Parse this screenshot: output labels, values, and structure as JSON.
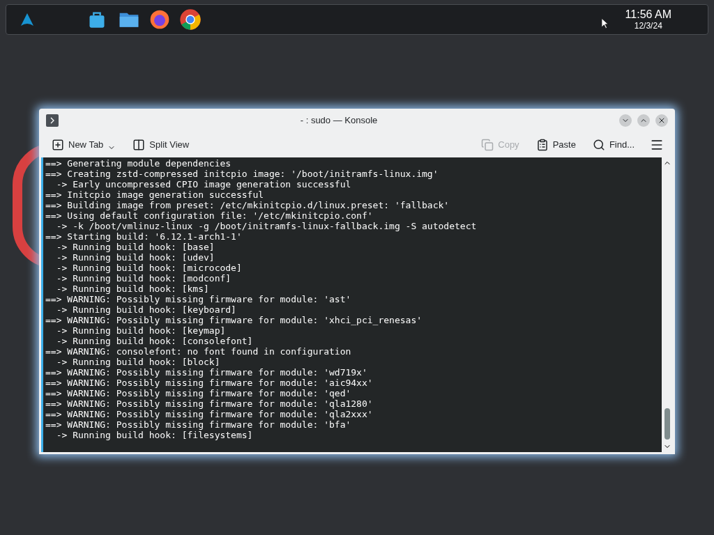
{
  "taskbar": {
    "clock": {
      "time": "11:56 AM",
      "date": "12/3/24"
    }
  },
  "window": {
    "title": "- : sudo — Konsole"
  },
  "toolbar": {
    "left": [
      {
        "label": "New Tab",
        "kind": "newtab",
        "disabled": false
      },
      {
        "label": "Split View",
        "kind": "split",
        "disabled": false
      }
    ],
    "right": [
      {
        "label": "Copy",
        "kind": "copy",
        "disabled": true
      },
      {
        "label": "Paste",
        "kind": "paste",
        "disabled": false
      },
      {
        "label": "Find...",
        "kind": "find",
        "disabled": false
      }
    ]
  },
  "terminal": {
    "lines": [
      "==> Generating module dependencies",
      "==> Creating zstd-compressed initcpio image: '/boot/initramfs-linux.img'",
      "  -> Early uncompressed CPIO image generation successful",
      "==> Initcpio image generation successful",
      "==> Building image from preset: /etc/mkinitcpio.d/linux.preset: 'fallback'",
      "==> Using default configuration file: '/etc/mkinitcpio.conf'",
      "  -> -k /boot/vmlinuz-linux -g /boot/initramfs-linux-fallback.img -S autodetect",
      "==> Starting build: '6.12.1-arch1-1'",
      "  -> Running build hook: [base]",
      "  -> Running build hook: [udev]",
      "  -> Running build hook: [microcode]",
      "  -> Running build hook: [modconf]",
      "  -> Running build hook: [kms]",
      "==> WARNING: Possibly missing firmware for module: 'ast'",
      "  -> Running build hook: [keyboard]",
      "==> WARNING: Possibly missing firmware for module: 'xhci_pci_renesas'",
      "  -> Running build hook: [keymap]",
      "  -> Running build hook: [consolefont]",
      "==> WARNING: consolefont: no font found in configuration",
      "  -> Running build hook: [block]",
      "==> WARNING: Possibly missing firmware for module: 'wd719x'",
      "==> WARNING: Possibly missing firmware for module: 'aic94xx'",
      "==> WARNING: Possibly missing firmware for module: 'qed'",
      "==> WARNING: Possibly missing firmware for module: 'qla1280'",
      "==> WARNING: Possibly missing firmware for module: 'qla2xxx'",
      "==> WARNING: Possibly missing firmware for module: 'bfa'",
      "  -> Running build hook: [filesystems]"
    ]
  }
}
